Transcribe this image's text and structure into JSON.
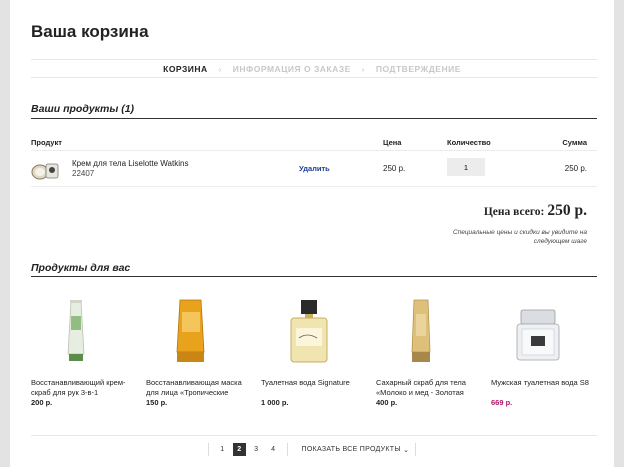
{
  "page": {
    "title": "Ваша корзина"
  },
  "steps": [
    {
      "label": "КОРЗИНА",
      "active": true
    },
    {
      "label": "ИНФОРМАЦИЯ О ЗАКАЗЕ",
      "active": false
    },
    {
      "label": "ПОДТВЕРЖДЕНИЕ",
      "active": false
    }
  ],
  "cart": {
    "section_title": "Ваши продукты (1)",
    "columns": {
      "product": "Продукт",
      "price": "Цена",
      "quantity": "Количество",
      "sum": "Сумма"
    },
    "items": [
      {
        "name": "Крем для тела Liselotte Watkins",
        "sku": "22407",
        "remove_label": "Удалить",
        "price": "250 р.",
        "quantity": "1",
        "sum": "250 р."
      }
    ],
    "total_label": "Цена всего:",
    "total_value": "250 р.",
    "note": "Специальные цены и скидки вы увидите на следующем шаге"
  },
  "recommended": {
    "section_title": "Продукты для вас",
    "products": [
      {
        "name": "Восстанавливающий крем-скраб для рук 3-в-1",
        "price": "200 р.",
        "sale": false
      },
      {
        "name": "Восстанавливающая маска для лица «Тропические",
        "price": "150 р.",
        "sale": false
      },
      {
        "name": "Туалетная вода Signature",
        "price": "1 000 р.",
        "sale": false
      },
      {
        "name": "Сахарный скраб для тела «Молоко и мед - Золотая",
        "price": "400 р.",
        "sale": false
      },
      {
        "name": "Мужская туалетная вода S8",
        "price": "669 р.",
        "sale": true
      }
    ]
  },
  "pager": {
    "pages": [
      "1",
      "2",
      "3",
      "4"
    ],
    "active_page": "2",
    "show_all": "ПОКАЗАТЬ ВСЕ ПРОДУКТЫ"
  },
  "colors": {
    "accent_link": "#1a3d8f",
    "sale_price": "#b0156b"
  },
  "icons": {
    "step_separator": "chevron-right-icon",
    "show_all": "chevron-down-icon"
  }
}
